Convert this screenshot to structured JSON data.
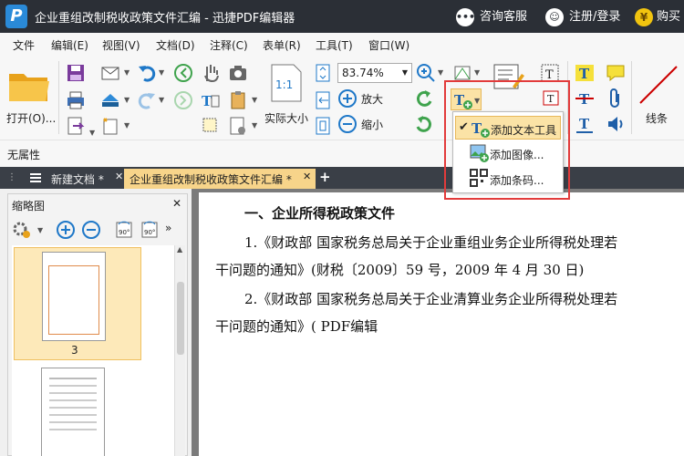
{
  "window": {
    "title": "企业重组改制税收政策文件汇编 - 迅捷PDF编辑器",
    "logo_letter": "P",
    "support_label": "咨询客服",
    "login_label": "注册/登录",
    "buy_label": "购买"
  },
  "menu": [
    "文件",
    "编辑(E)",
    "视图(V)",
    "文档(D)",
    "注释(C)",
    "表单(R)",
    "工具(T)",
    "窗口(W)"
  ],
  "toolbar": {
    "open_label": "打开(O)...",
    "zoom_value": "83.74%",
    "actual_size_label": "实际大小",
    "actual_size_glyph": "1:1",
    "zoom_in_label": "放大",
    "zoom_out_label": "缩小",
    "line_label": "线条"
  },
  "properties_label": "无属性",
  "tabs": [
    {
      "label": "新建文档 *",
      "active": false
    },
    {
      "label": "企业重组改制税收政策文件汇编 *",
      "active": true
    }
  ],
  "thumbnail_panel": {
    "title": "缩略图",
    "selected_page": "3",
    "rotate_labels": [
      "90°",
      "90°"
    ]
  },
  "dropdown": {
    "items": [
      "添加文本工具",
      "添加图像...",
      "添加条码..."
    ]
  },
  "document": {
    "heading": "一、企业所得税政策文件",
    "lines": [
      "1.《财政部 国家税务总局关于企业重组业务企业所得税处理若",
      "干问题的通知》(财税〔2009〕59 号，2009 年 4 月 30 日)",
      "2.《财政部 国家税务总局关于企业清算业务企业所得税处理若",
      "干问题的通知》( PDF编辑"
    ]
  },
  "colors": {
    "titlebar": "#2b2f36",
    "accent": "#2a8ad8",
    "tab_active": "#f7d48a",
    "highlight": "#e23b3b",
    "menu_hover": "#fbe3a6"
  }
}
